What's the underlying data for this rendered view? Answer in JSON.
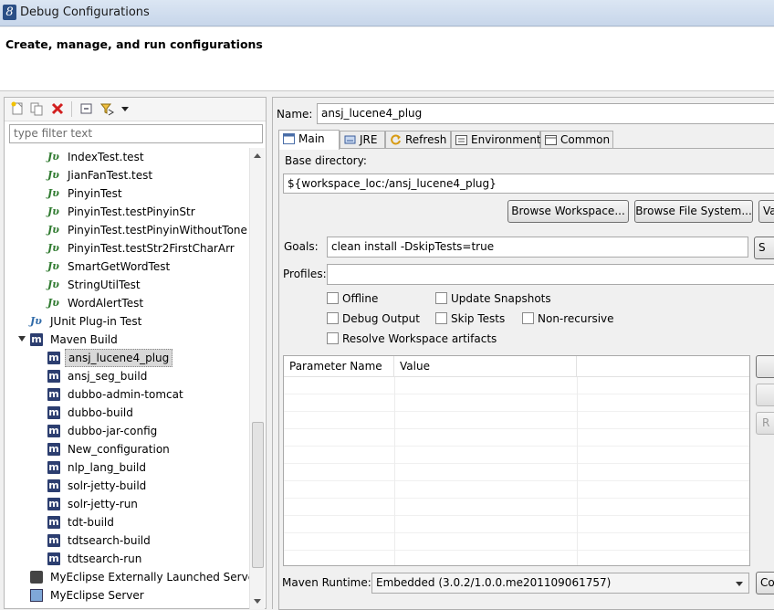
{
  "window": {
    "title": "Debug Configurations",
    "app_icon_glyph": "8"
  },
  "header": {
    "title": "Create, manage, and run configurations"
  },
  "left": {
    "toolbar_icons": [
      "new-configuration-icon",
      "duplicate-icon",
      "delete-icon",
      "collapse-all-icon",
      "filter-icon",
      "dropdown-arrow-icon"
    ],
    "filter_placeholder": "type filter text",
    "tree": [
      {
        "label": "IndexTest.test",
        "icon": "junit-icon",
        "level": 2
      },
      {
        "label": "JianFanTest.test",
        "icon": "junit-icon",
        "level": 2
      },
      {
        "label": "PinyinTest",
        "icon": "junit-icon",
        "level": 2
      },
      {
        "label": "PinyinTest.testPinyinStr",
        "icon": "junit-icon",
        "level": 2
      },
      {
        "label": "PinyinTest.testPinyinWithoutTone",
        "icon": "junit-icon",
        "level": 2
      },
      {
        "label": "PinyinTest.testStr2FirstCharArr",
        "icon": "junit-icon",
        "level": 2
      },
      {
        "label": "SmartGetWordTest",
        "icon": "junit-icon",
        "level": 2
      },
      {
        "label": "StringUtilTest",
        "icon": "junit-icon",
        "level": 2
      },
      {
        "label": "WordAlertTest",
        "icon": "junit-icon",
        "level": 2
      },
      {
        "label": "JUnit Plug-in Test",
        "icon": "junit-plugin-icon",
        "level": 1
      },
      {
        "label": "Maven Build",
        "icon": "maven-icon",
        "level": 1,
        "expanded": true
      },
      {
        "label": "ansj_lucene4_plug",
        "icon": "maven-icon",
        "level": 2,
        "selected": true
      },
      {
        "label": "ansj_seg_build",
        "icon": "maven-icon",
        "level": 2
      },
      {
        "label": "dubbo-admin-tomcat",
        "icon": "maven-icon",
        "level": 2
      },
      {
        "label": "dubbo-build",
        "icon": "maven-icon",
        "level": 2
      },
      {
        "label": "dubbo-jar-config",
        "icon": "maven-icon",
        "level": 2
      },
      {
        "label": "New_configuration",
        "icon": "maven-icon",
        "level": 2
      },
      {
        "label": "nlp_lang_build",
        "icon": "maven-icon",
        "level": 2
      },
      {
        "label": "solr-jetty-build",
        "icon": "maven-icon",
        "level": 2
      },
      {
        "label": "solr-jetty-run",
        "icon": "maven-icon",
        "level": 2
      },
      {
        "label": "tdt-build",
        "icon": "maven-icon",
        "level": 2
      },
      {
        "label": "tdtsearch-build",
        "icon": "maven-icon",
        "level": 2
      },
      {
        "label": "tdtsearch-run",
        "icon": "maven-icon",
        "level": 2
      },
      {
        "label": "MyEclipse Externally Launched Server",
        "icon": "external-server-icon",
        "level": 1
      },
      {
        "label": "MyEclipse Server",
        "icon": "server-icon",
        "level": 1
      }
    ]
  },
  "right": {
    "name_label": "Name:",
    "name_value": "ansj_lucene4_plug",
    "tabs": [
      {
        "label": "Main",
        "icon": "main-tab-icon",
        "active": true
      },
      {
        "label": "JRE",
        "icon": "jre-icon"
      },
      {
        "label": "Refresh",
        "icon": "refresh-icon"
      },
      {
        "label": "Environment",
        "icon": "environment-icon"
      },
      {
        "label": "Common",
        "icon": "common-icon"
      }
    ],
    "base_dir_label": "Base directory:",
    "base_dir_value": "${workspace_loc:/ansj_lucene4_plug}",
    "browse_workspace": "Browse Workspace...",
    "browse_filesystem": "Browse File System...",
    "variables_partial": "Va",
    "goals_label": "Goals:",
    "goals_value": "clean install -DskipTests=true",
    "select_partial": "S",
    "profiles_label": "Profiles:",
    "profiles_value": "",
    "checkboxes": {
      "offline": "Offline",
      "update_snapshots": "Update Snapshots",
      "debug_output": "Debug Output",
      "skip_tests": "Skip Tests",
      "non_recursive": "Non-recursive",
      "resolve_workspace": "Resolve Workspace artifacts"
    },
    "params_table": {
      "columns": [
        "Parameter Name",
        "Value"
      ]
    },
    "side_button_partial": "R",
    "runtime_label": "Maven Runtime:",
    "runtime_value": "Embedded (3.0.2/1.0.0.me201109061757)",
    "configure_partial": "Co"
  }
}
